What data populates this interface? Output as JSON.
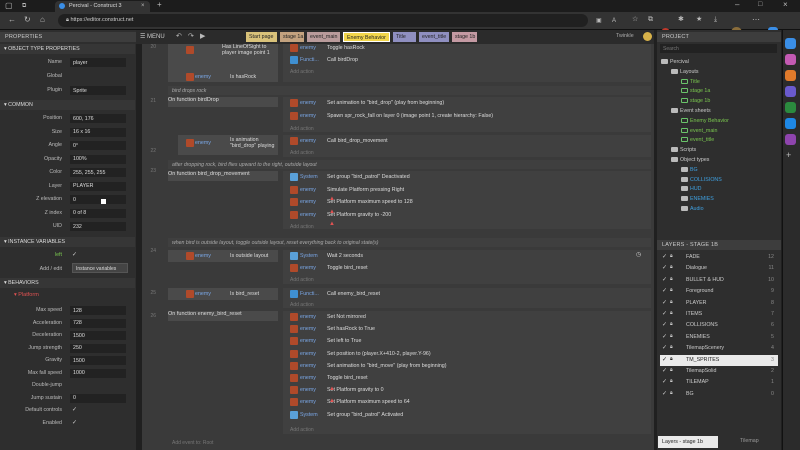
{
  "browser": {
    "tab_title": "Percival - Construct 3",
    "url": "https://editor.construct.net"
  },
  "menu": {
    "label": "MENU"
  },
  "properties": {
    "header": "PROPERTIES",
    "section_obj": "OBJECT TYPE PROPERTIES",
    "obj_rows": [
      {
        "label": "Name",
        "value": "player"
      },
      {
        "label": "Global",
        "value": ""
      },
      {
        "label": "Plugin",
        "value": "Sprite"
      }
    ],
    "section_common": "COMMON",
    "common_rows": [
      {
        "label": "Position",
        "value": "600, 176"
      },
      {
        "label": "Size",
        "value": "16 x 16"
      },
      {
        "label": "Angle",
        "value": "0°"
      },
      {
        "label": "Opacity",
        "value": "100%"
      },
      {
        "label": "Color",
        "value": "255, 255, 255"
      },
      {
        "label": "Layer",
        "value": "PLAYER"
      },
      {
        "label": "Z elevation",
        "value": "0"
      },
      {
        "label": "Z index",
        "value": "0 of 8"
      },
      {
        "label": "UID",
        "value": "232"
      }
    ],
    "section_iv": "INSTANCE VARIABLES",
    "iv_left": "left",
    "iv_addedit": "Add / edit",
    "iv_button": "Instance variables",
    "section_beh": "BEHAVIORS",
    "platform": "Platform",
    "beh_rows": [
      {
        "label": "Max speed",
        "value": "128"
      },
      {
        "label": "Acceleration",
        "value": "728"
      },
      {
        "label": "Deceleration",
        "value": "1500"
      },
      {
        "label": "Jump strength",
        "value": "250"
      },
      {
        "label": "Gravity",
        "value": "1500"
      },
      {
        "label": "Max fall speed",
        "value": "1000"
      },
      {
        "label": "Double-jump",
        "value": ""
      },
      {
        "label": "Jump sustain",
        "value": "0"
      },
      {
        "label": "Default controls",
        "value": ""
      },
      {
        "label": "Enabled",
        "value": ""
      }
    ]
  },
  "editor_tabs": [
    "Start page",
    "stage 1a",
    "event_main",
    "Enemy Behavior",
    "Title",
    "event_title",
    "stage 1b"
  ],
  "active_tab": "Enemy Behavior",
  "user": "Twinkle",
  "events": {
    "top_conds": [
      "Has",
      "LineOfSight to",
      "player",
      "image point 1",
      "enemy",
      "Is hasRock"
    ],
    "top_acts": [
      "Toggle hasRock",
      "Call birdDrop"
    ],
    "add_action": "Add action",
    "c1": "bird drops rock",
    "f1": "On function birdDrop",
    "f1_acts": [
      "Set animation to \"bird_drop\" (play from beginning)",
      "Spawn spr_rock_fall on layer 0 (image point 1, create hierarchy: False)"
    ],
    "f1_sub": "Is animation \"bird_drop\" playing",
    "f1_sub_act": "Call bird_drop_movement",
    "c2": "after dropping rock, bird flies upward to the right, outside layout",
    "f2": "On function bird_drop_movement",
    "f2_acts": [
      "Set group \"bird_patrol\" Deactivated",
      "Simulate Platform pressing Right",
      "Set Platform maximum speed to 128",
      "Set Platform gravity to -200"
    ],
    "c3": "when bird is outside layout, toggle outside layout, reset everything back to original state(s)",
    "e3_cond": "Is outside layout",
    "e3_acts": [
      "Wait 2 seconds",
      "Toggle bird_reset"
    ],
    "e4_cond": "Is bird_reset",
    "e4_act": "Call enemy_bird_reset",
    "f3": "On function enemy_bird_reset",
    "f3_acts": [
      "Set Not mirrored",
      "Set hasRock to True",
      "Set left to True",
      "Set position to (player.X+410-2, player.Y-96)",
      "Set animation to \"bird_move\" (play from beginning)",
      "Toggle bird_reset",
      "Set Platform gravity to 0",
      "Set Platform maximum speed to 64",
      "Set group \"bird_patrol\" Activated"
    ],
    "obj_enemy": "enemy",
    "obj_system": "System",
    "obj_funcs": "Functi...",
    "line_nums": [
      "20",
      "21",
      "22",
      "23",
      "24",
      "25",
      "26",
      "27",
      "28"
    ],
    "add_event": "Add event to: Root"
  },
  "project": {
    "header": "PROJECT",
    "search_placeholder": "Search",
    "tree": [
      {
        "label": "Percival",
        "lvl": 0
      },
      {
        "label": "Layouts",
        "lvl": 1
      },
      {
        "label": "Title",
        "lvl": 2,
        "sel": true
      },
      {
        "label": "stage 1a",
        "lvl": 2,
        "sel": true
      },
      {
        "label": "stage 1b",
        "lvl": 2,
        "sel": true
      },
      {
        "label": "Event sheets",
        "lvl": 1
      },
      {
        "label": "Enemy Behavior",
        "lvl": 2,
        "sel": true
      },
      {
        "label": "event_main",
        "lvl": 2,
        "sel": true
      },
      {
        "label": "event_title",
        "lvl": 2,
        "sel": true
      },
      {
        "label": "Scripts",
        "lvl": 1
      },
      {
        "label": "Object types",
        "lvl": 1
      },
      {
        "label": "BG",
        "lvl": 2
      },
      {
        "label": "COLLISIONS",
        "lvl": 2
      },
      {
        "label": "HUD",
        "lvl": 2
      },
      {
        "label": "ENEMIES",
        "lvl": 2
      },
      {
        "label": "Audio",
        "lvl": 2
      }
    ]
  },
  "layers": {
    "header": "LAYERS - STAGE 1B",
    "rows": [
      {
        "name": "FADE",
        "num": "12"
      },
      {
        "name": "Dialogue",
        "num": "11"
      },
      {
        "name": "BULLET & HUD",
        "num": "10"
      },
      {
        "name": "Foreground",
        "num": "9"
      },
      {
        "name": "PLAYER",
        "num": "8"
      },
      {
        "name": "ITEMS",
        "num": "7"
      },
      {
        "name": "COLLISIONS",
        "num": "6"
      },
      {
        "name": "ENEMIES",
        "num": "5"
      },
      {
        "name": "TilemapScenery",
        "num": "4"
      },
      {
        "name": "TM_SPRITES",
        "num": "3",
        "sel": true
      },
      {
        "name": "TilemapSolid",
        "num": "2"
      },
      {
        "name": "TILEMAP",
        "num": "1"
      },
      {
        "name": "BG",
        "num": "0"
      }
    ],
    "tabs": [
      "Layers - stage 1b",
      "Tilemap"
    ]
  }
}
